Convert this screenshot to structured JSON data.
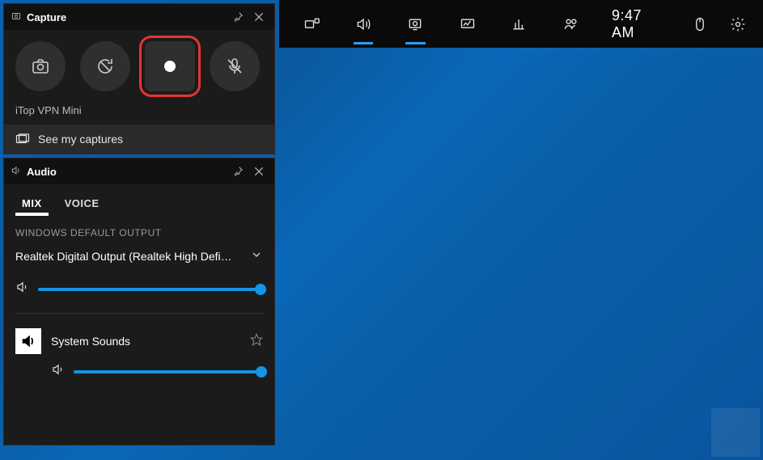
{
  "toolbar": {
    "clock": "9:47 AM",
    "items": [
      {
        "name": "widgets-icon",
        "active": false
      },
      {
        "name": "audio-icon",
        "active": true
      },
      {
        "name": "capture-icon",
        "active": true
      },
      {
        "name": "performance-icon",
        "active": false
      },
      {
        "name": "resources-icon",
        "active": false
      },
      {
        "name": "xbox-social-icon",
        "active": false
      }
    ],
    "right_items": [
      {
        "name": "mouse-icon"
      },
      {
        "name": "settings-icon"
      }
    ]
  },
  "capture": {
    "title": "Capture",
    "subtitle": "iTop VPN Mini",
    "see_captures_label": "See my captures",
    "buttons": {
      "screenshot": "Take screenshot",
      "record_last": "Record last",
      "record": "Start recording",
      "mic": "Microphone"
    }
  },
  "audio": {
    "title": "Audio",
    "tabs": {
      "mix": "MIX",
      "voice": "VOICE",
      "active": "mix"
    },
    "section_label": "WINDOWS DEFAULT OUTPUT",
    "device_name": "Realtek Digital Output (Realtek High Defi…",
    "master_volume_pct": 99,
    "apps": [
      {
        "name": "System Sounds",
        "volume_pct": 99
      }
    ]
  }
}
